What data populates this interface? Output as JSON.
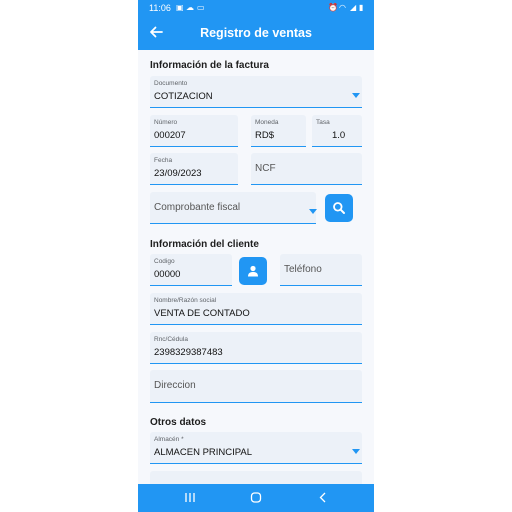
{
  "status_bar": {
    "time": "11:06"
  },
  "header": {
    "title": "Registro de ventas",
    "back_icon": "arrow-left-icon"
  },
  "invoice": {
    "section_title": "Información de la factura",
    "document": {
      "label": "Documento",
      "value": "COTIZACION"
    },
    "number": {
      "label": "Número",
      "value": "000207"
    },
    "currency": {
      "label": "Moneda",
      "value": "RD$"
    },
    "rate": {
      "label": "Tasa",
      "value": "1.0"
    },
    "date": {
      "label": "Fecha",
      "value": "23/09/2023"
    },
    "ncf": {
      "placeholder": "NCF"
    },
    "fiscal_voucher": {
      "placeholder": "Comprobante fiscal"
    },
    "search_icon": "search-icon"
  },
  "client": {
    "section_title": "Información del cliente",
    "code": {
      "label": "Codigo",
      "value": "00000"
    },
    "phone": {
      "placeholder": "Teléfono"
    },
    "person_icon": "person-icon",
    "name": {
      "label": "Nombre/Razón social",
      "value": "VENTA DE CONTADO"
    },
    "rnc": {
      "label": "Rnc/Cédula",
      "value": "2398329387483"
    },
    "address": {
      "placeholder": "Direccion"
    }
  },
  "other": {
    "section_title": "Otros datos",
    "warehouse": {
      "label": "Almacén *",
      "value": "ALMACEN PRINCIPAL"
    }
  },
  "colors": {
    "accent": "#2196f3",
    "field_bg": "#ecf1f8",
    "background": "#f6f8fc"
  }
}
